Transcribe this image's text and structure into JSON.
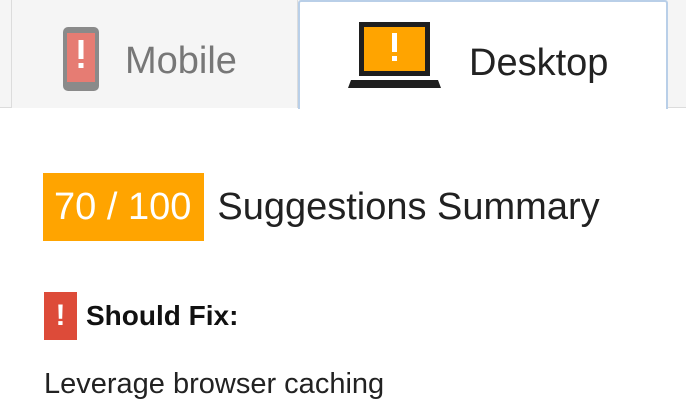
{
  "tabs": {
    "mobile": {
      "label": "Mobile",
      "icon": "phone-icon",
      "selected": false
    },
    "desktop": {
      "label": "Desktop",
      "icon": "laptop-icon",
      "selected": true
    }
  },
  "summary": {
    "score": "70 / 100",
    "title": "Suggestions Summary"
  },
  "should_fix": {
    "icon_glyph": "!",
    "label": "Should Fix:",
    "items": [
      "Leverage browser caching"
    ]
  },
  "colors": {
    "score_badge": "#ffa400",
    "warning": "#dd4b39",
    "mobile_phone": "#e67c73",
    "laptop_screen": "#ffa400",
    "selected_tab_border": "#b9cfe8"
  }
}
